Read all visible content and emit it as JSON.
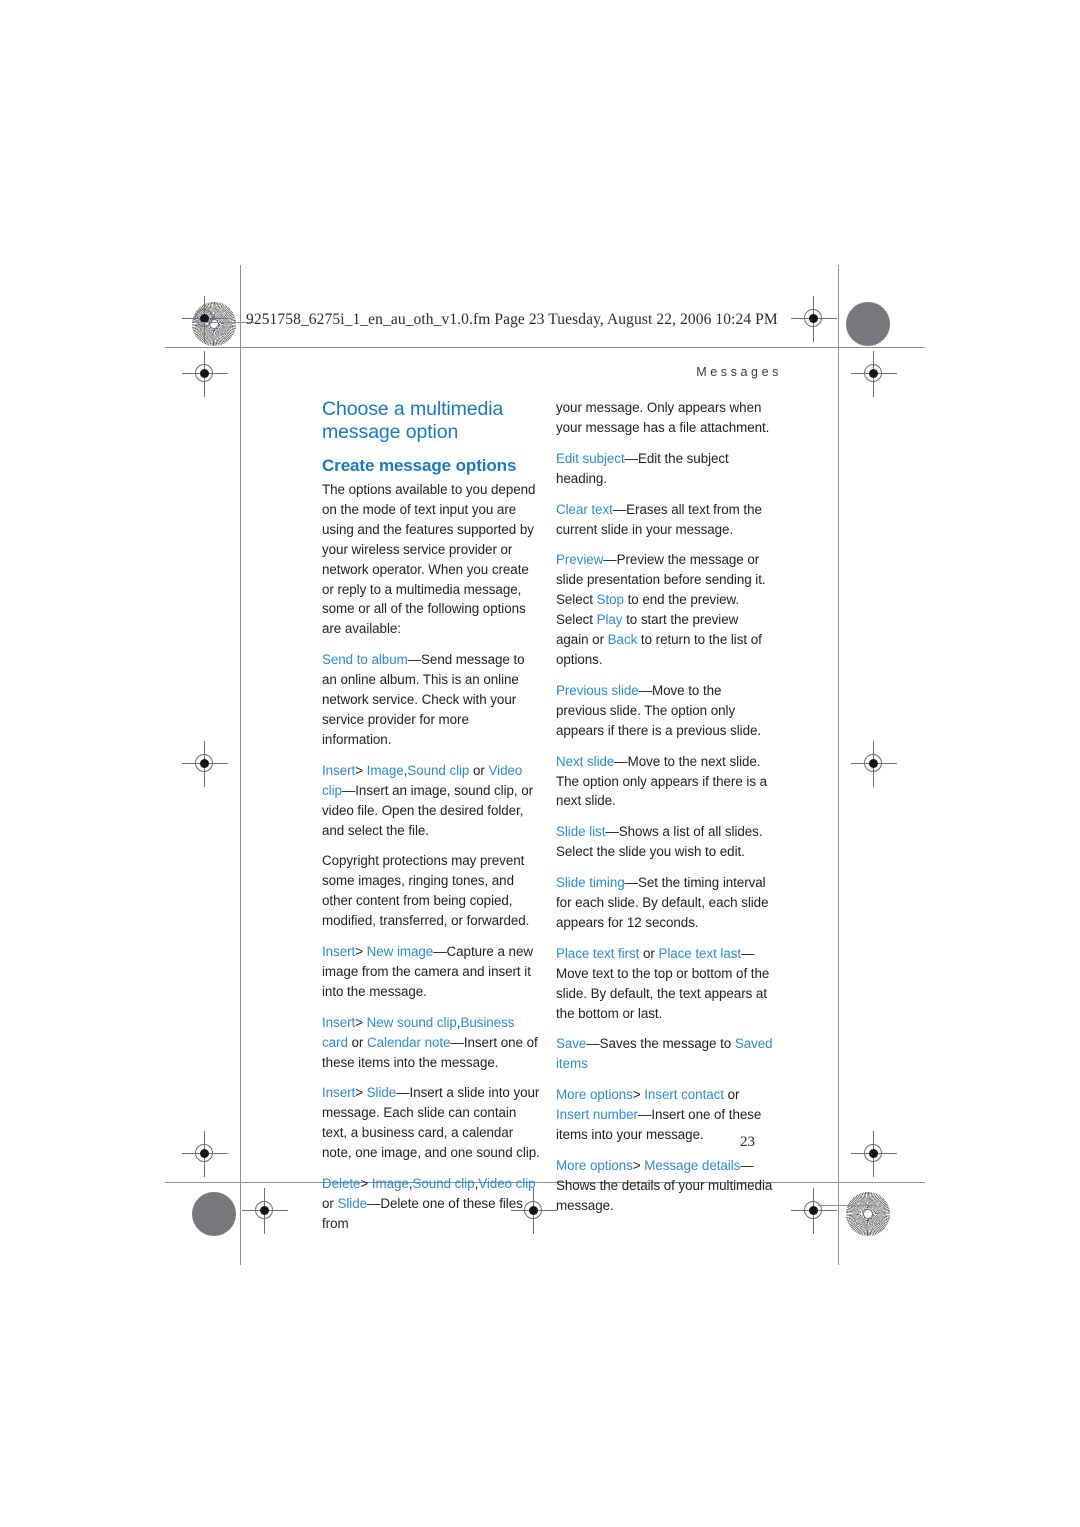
{
  "document": {
    "slug": "9251758_6275i_1_en_au_oth_v1.0.fm  Page 23  Tuesday, August 22, 2006  10:24 PM",
    "running_head": "Messages",
    "page_number": "23",
    "colors": {
      "heading_blue": "#1878c0",
      "link_blue": "#2e8bd4",
      "body_text": "#231f20",
      "mark_gray": "#6e6e74"
    }
  },
  "left_column": {
    "title": "Choose a multimedia message option",
    "subtitle": "Create message options",
    "paragraphs": [
      {
        "id": "intro",
        "runs": [
          {
            "text": "The options available to you depend on the mode of text input you are using and the features supported by your wireless service provider or network operator. When you create or reply to a multimedia message, some or all of the following options are available:",
            "style": "body"
          }
        ]
      },
      {
        "id": "send-to-album",
        "runs": [
          {
            "text": "Send to album",
            "style": "link"
          },
          {
            "text": "—",
            "style": "rule"
          },
          {
            "text": "Send message to an online album. This is an online network service. Check with your service provider for more information.",
            "style": "body"
          }
        ]
      },
      {
        "id": "insert-image",
        "runs": [
          {
            "text": "Insert",
            "style": "link"
          },
          {
            "text": ">",
            "style": "body"
          },
          {
            "text": " Image",
            "style": "link"
          },
          {
            "text": ",",
            "style": "body"
          },
          {
            "text": "Sound clip",
            "style": "link"
          },
          {
            "text": " or ",
            "style": "body"
          },
          {
            "text": "Video clip",
            "style": "link"
          },
          {
            "text": "—",
            "style": "rule"
          },
          {
            "text": "Insert an image, sound clip, or video file. Open the desired folder, and select the file.",
            "style": "body"
          }
        ]
      },
      {
        "id": "copyright",
        "runs": [
          {
            "text": "Copyright protections may prevent some images, ringing tones, and other content from being copied, modified, transferred, or forwarded.",
            "style": "body"
          }
        ]
      },
      {
        "id": "insert-new-image",
        "runs": [
          {
            "text": "Insert",
            "style": "link"
          },
          {
            "text": ">",
            "style": "body"
          },
          {
            "text": " New image",
            "style": "link"
          },
          {
            "text": "—",
            "style": "rule"
          },
          {
            "text": "Capture a new image from the camera and insert it into the message.",
            "style": "body"
          }
        ]
      },
      {
        "id": "insert-new-sound-clip",
        "runs": [
          {
            "text": "Insert",
            "style": "link"
          },
          {
            "text": ">",
            "style": "body"
          },
          {
            "text": " New sound clip",
            "style": "link"
          },
          {
            "text": ",",
            "style": "body"
          },
          {
            "text": "Business card",
            "style": "link"
          },
          {
            "text": " or ",
            "style": "body"
          },
          {
            "text": "Calendar note",
            "style": "link"
          },
          {
            "text": "—",
            "style": "rule"
          },
          {
            "text": "Insert one of these items into the message.",
            "style": "body"
          }
        ]
      },
      {
        "id": "insert-slide",
        "runs": [
          {
            "text": "Insert",
            "style": "link"
          },
          {
            "text": ">",
            "style": "body"
          },
          {
            "text": " Slide",
            "style": "link"
          },
          {
            "text": "—",
            "style": "rule"
          },
          {
            "text": "Insert a slide into your message. Each slide can contain text, a business card, a calendar note, one image, and one sound clip.",
            "style": "body"
          }
        ]
      },
      {
        "id": "delete",
        "runs": [
          {
            "text": "Delete",
            "style": "link"
          },
          {
            "text": ">",
            "style": "body"
          },
          {
            "text": " Image",
            "style": "link"
          },
          {
            "text": ",",
            "style": "body"
          },
          {
            "text": "Sound clip",
            "style": "link"
          },
          {
            "text": ",",
            "style": "body"
          },
          {
            "text": "Video clip",
            "style": "link"
          },
          {
            "text": " or ",
            "style": "body"
          },
          {
            "text": "Slide",
            "style": "link"
          },
          {
            "text": "—",
            "style": "rule"
          },
          {
            "text": "Delete one of these files from",
            "style": "body"
          }
        ]
      }
    ]
  },
  "right_column": {
    "paragraphs": [
      {
        "id": "continuation",
        "runs": [
          {
            "text": "your message. Only appears when your message has a file attachment.",
            "style": "body"
          }
        ]
      },
      {
        "id": "edit-subject",
        "runs": [
          {
            "text": "Edit subject",
            "style": "link"
          },
          {
            "text": "—",
            "style": "rule"
          },
          {
            "text": "Edit the subject heading.",
            "style": "body"
          }
        ]
      },
      {
        "id": "clear-text",
        "runs": [
          {
            "text": "Clear text",
            "style": "link"
          },
          {
            "text": "—",
            "style": "rule"
          },
          {
            "text": "Erases all text from the current slide in your message.",
            "style": "body"
          }
        ]
      },
      {
        "id": "preview",
        "runs": [
          {
            "text": "Preview",
            "style": "link"
          },
          {
            "text": "—",
            "style": "rule"
          },
          {
            "text": "Preview the message or slide presentation before sending it. Select ",
            "style": "body"
          },
          {
            "text": "Stop",
            "style": "link"
          },
          {
            "text": " to end the preview. Select ",
            "style": "body"
          },
          {
            "text": "Play",
            "style": "link"
          },
          {
            "text": " to start the preview again or ",
            "style": "body"
          },
          {
            "text": "Back",
            "style": "link"
          },
          {
            "text": " to return to the list of options.",
            "style": "body"
          }
        ]
      },
      {
        "id": "previous-slide",
        "runs": [
          {
            "text": "Previous slide",
            "style": "link"
          },
          {
            "text": "—",
            "style": "rule"
          },
          {
            "text": "Move to the previous slide. The option only appears if there is a previous slide.",
            "style": "body"
          }
        ]
      },
      {
        "id": "next-slide",
        "runs": [
          {
            "text": "Next slide",
            "style": "link"
          },
          {
            "text": "—",
            "style": "rule"
          },
          {
            "text": "Move to the next slide. The option only appears if there is a next slide.",
            "style": "body"
          }
        ]
      },
      {
        "id": "slide-list",
        "runs": [
          {
            "text": "Slide list",
            "style": "link"
          },
          {
            "text": "—",
            "style": "rule"
          },
          {
            "text": "Shows a list of all slides. Select the slide you wish to edit.",
            "style": "body"
          }
        ]
      },
      {
        "id": "slide-timing",
        "runs": [
          {
            "text": "Slide timing",
            "style": "link"
          },
          {
            "text": "—",
            "style": "rule"
          },
          {
            "text": "Set the timing interval for each slide. By default, each slide appears for 12 seconds.",
            "style": "body"
          }
        ]
      },
      {
        "id": "place-text",
        "runs": [
          {
            "text": "Place text first",
            "style": "link"
          },
          {
            "text": " or ",
            "style": "body"
          },
          {
            "text": "Place text last",
            "style": "link"
          },
          {
            "text": "—",
            "style": "rule"
          },
          {
            "text": "Move text to the top or bottom of the slide. By default, the text appears at the bottom or last.",
            "style": "body"
          }
        ]
      },
      {
        "id": "save",
        "runs": [
          {
            "text": "Save",
            "style": "link"
          },
          {
            "text": "—",
            "style": "rule"
          },
          {
            "text": "Saves the message to ",
            "style": "body"
          },
          {
            "text": "Saved items",
            "style": "link"
          }
        ]
      },
      {
        "id": "more-options-insert-contact",
        "runs": [
          {
            "text": "More options",
            "style": "link"
          },
          {
            "text": ">",
            "style": "body"
          },
          {
            "text": " Insert contact",
            "style": "link"
          },
          {
            "text": " or ",
            "style": "body"
          },
          {
            "text": "Insert number",
            "style": "link"
          },
          {
            "text": "—",
            "style": "rule"
          },
          {
            "text": "Insert one of these items into your message.",
            "style": "body"
          }
        ]
      },
      {
        "id": "more-options-message-details",
        "runs": [
          {
            "text": "More options",
            "style": "link"
          },
          {
            "text": ">",
            "style": "body"
          },
          {
            "text": " Message details",
            "style": "link"
          },
          {
            "text": "—",
            "style": "rule"
          },
          {
            "text": "Shows the details of your multimedia message.",
            "style": "body"
          }
        ]
      }
    ]
  }
}
